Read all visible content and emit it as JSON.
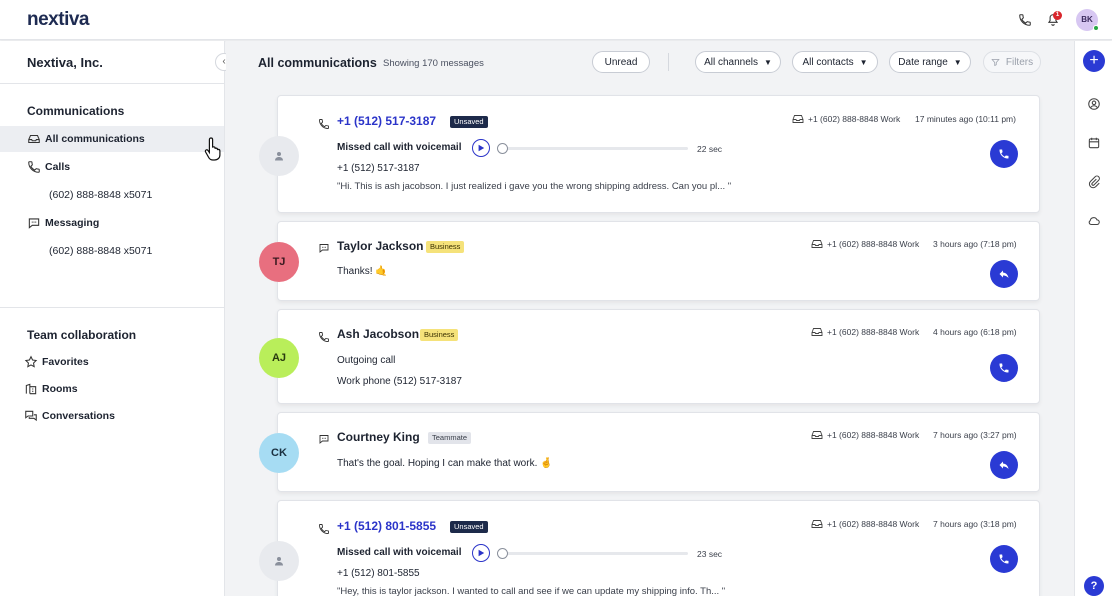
{
  "header": {
    "logo": "nextiva",
    "notification_count": "1",
    "user_initials": "BK"
  },
  "sidebar": {
    "org_name": "Nextiva, Inc.",
    "collapse_glyph": "‹",
    "communications_title": "Communications",
    "items": [
      {
        "label": "All communications",
        "icon": "inbox-icon"
      },
      {
        "label": "Calls",
        "icon": "phone-icon"
      },
      {
        "label": "(602) 888-8848 x5071"
      },
      {
        "label": "Messaging",
        "icon": "chat-icon"
      },
      {
        "label": "(602) 888-8848 x5071"
      }
    ],
    "team_title": "Team collaboration",
    "team_items": [
      {
        "label": "Favorites",
        "icon": "star-icon"
      },
      {
        "label": "Rooms",
        "icon": "rooms-icon"
      },
      {
        "label": "Conversations",
        "icon": "conversations-icon"
      }
    ]
  },
  "toolbar": {
    "title": "All communications",
    "count": "Showing 170 messages",
    "unread": "Unread",
    "channels": "All channels",
    "contacts": "All contacts",
    "date_range": "Date range",
    "filters": "Filters"
  },
  "cards": [
    {
      "name": "+1 (512) 517-3187",
      "tag": "Unsaved",
      "status": "Missed call with voicemail",
      "duration": "22 sec",
      "number": "+1 (512) 517-3187",
      "transcript": "\"Hi. This is ash jacobson. I just realized i gave you the wrong shipping address. Can you pl... \"",
      "line": "+1 (602) 888-8848 Work",
      "time": "17 minutes ago (10:11 pm)"
    },
    {
      "initials": "TJ",
      "name": "Taylor Jackson",
      "tag": "Business",
      "message": "Thanks! 🤙",
      "line": "+1 (602) 888-8848 Work",
      "time": "3 hours ago (7:18 pm)"
    },
    {
      "initials": "AJ",
      "name": "Ash Jacobson",
      "tag": "Business",
      "status": "Outgoing call",
      "detail": "Work phone (512) 517-3187",
      "line": "+1 (602) 888-8848 Work",
      "time": "4 hours ago (6:18 pm)"
    },
    {
      "initials": "CK",
      "name": "Courtney King",
      "tag": "Teammate",
      "message": "That's the goal. Hoping I can make that work. 🤞",
      "line": "+1 (602) 888-8848 Work",
      "time": "7 hours ago (3:27 pm)"
    },
    {
      "name": "+1 (512) 801-5855",
      "tag": "Unsaved",
      "status": "Missed call with voicemail",
      "duration": "23 sec",
      "number": "+1 (512) 801-5855",
      "transcript": "\"Hey, this is taylor jackson. I wanted to call and see if we can update my shipping info. Th... \"",
      "line": "+1 (602) 888-8848 Work",
      "time": "7 hours ago (3:18 pm)"
    }
  ],
  "rail": {
    "add": "+",
    "help": "?"
  },
  "colors": {
    "brand_blue": "#2a3ad4",
    "link_blue": "#2b34c9",
    "business_tag": "#f5e27a",
    "unsaved_tag": "#1d2a4a"
  }
}
